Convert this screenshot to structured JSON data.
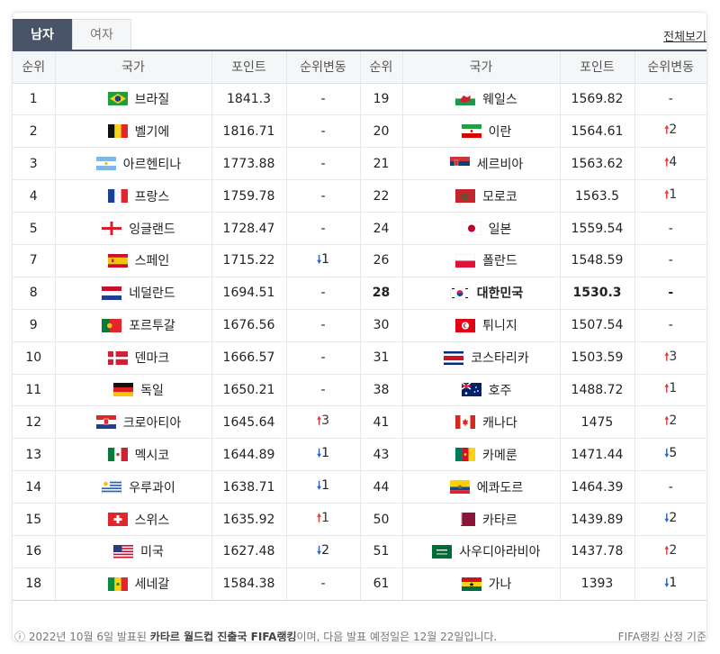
{
  "tabs": [
    {
      "label": "남자",
      "active": true
    },
    {
      "label": "여자",
      "active": false
    }
  ],
  "view_all": "전체보기",
  "headers": [
    "순위",
    "국가",
    "포인트",
    "순위변동",
    "순위",
    "국가",
    "포인트",
    "순위변동"
  ],
  "left": [
    {
      "rank": "1",
      "country": "브라질",
      "points": "1841.3",
      "change": "-",
      "flag": "brazil"
    },
    {
      "rank": "2",
      "country": "벨기에",
      "points": "1816.71",
      "change": "-",
      "flag": "belgium"
    },
    {
      "rank": "3",
      "country": "아르헨티나",
      "points": "1773.88",
      "change": "-",
      "flag": "argentina"
    },
    {
      "rank": "4",
      "country": "프랑스",
      "points": "1759.78",
      "change": "-",
      "flag": "france"
    },
    {
      "rank": "5",
      "country": "잉글랜드",
      "points": "1728.47",
      "change": "-",
      "flag": "england"
    },
    {
      "rank": "7",
      "country": "스페인",
      "points": "1715.22",
      "change": "1",
      "dir": "down",
      "flag": "spain"
    },
    {
      "rank": "8",
      "country": "네덜란드",
      "points": "1694.51",
      "change": "-",
      "flag": "netherlands"
    },
    {
      "rank": "9",
      "country": "포르투갈",
      "points": "1676.56",
      "change": "-",
      "flag": "portugal"
    },
    {
      "rank": "10",
      "country": "덴마크",
      "points": "1666.57",
      "change": "-",
      "flag": "denmark"
    },
    {
      "rank": "11",
      "country": "독일",
      "points": "1650.21",
      "change": "-",
      "flag": "germany"
    },
    {
      "rank": "12",
      "country": "크로아티아",
      "points": "1645.64",
      "change": "3",
      "dir": "up",
      "flag": "croatia"
    },
    {
      "rank": "13",
      "country": "멕시코",
      "points": "1644.89",
      "change": "1",
      "dir": "down",
      "flag": "mexico"
    },
    {
      "rank": "14",
      "country": "우루과이",
      "points": "1638.71",
      "change": "1",
      "dir": "down",
      "flag": "uruguay"
    },
    {
      "rank": "15",
      "country": "스위스",
      "points": "1635.92",
      "change": "1",
      "dir": "up",
      "flag": "switzerland"
    },
    {
      "rank": "16",
      "country": "미국",
      "points": "1627.48",
      "change": "2",
      "dir": "down",
      "flag": "usa"
    },
    {
      "rank": "18",
      "country": "세네갈",
      "points": "1584.38",
      "change": "-",
      "flag": "senegal"
    }
  ],
  "right": [
    {
      "rank": "19",
      "country": "웨일스",
      "points": "1569.82",
      "change": "-",
      "flag": "wales"
    },
    {
      "rank": "20",
      "country": "이란",
      "points": "1564.61",
      "change": "2",
      "dir": "up",
      "flag": "iran"
    },
    {
      "rank": "21",
      "country": "세르비아",
      "points": "1563.62",
      "change": "4",
      "dir": "up",
      "flag": "serbia"
    },
    {
      "rank": "22",
      "country": "모로코",
      "points": "1563.5",
      "change": "1",
      "dir": "up",
      "flag": "morocco"
    },
    {
      "rank": "24",
      "country": "일본",
      "points": "1559.54",
      "change": "-",
      "flag": "japan"
    },
    {
      "rank": "26",
      "country": "폴란드",
      "points": "1548.59",
      "change": "-",
      "flag": "poland"
    },
    {
      "rank": "28",
      "country": "대한민국",
      "points": "1530.3",
      "change": "-",
      "flag": "korea",
      "highlight": true
    },
    {
      "rank": "30",
      "country": "튀니지",
      "points": "1507.54",
      "change": "-",
      "flag": "tunisia"
    },
    {
      "rank": "31",
      "country": "코스타리카",
      "points": "1503.59",
      "change": "3",
      "dir": "up",
      "flag": "costarica"
    },
    {
      "rank": "38",
      "country": "호주",
      "points": "1488.72",
      "change": "1",
      "dir": "up",
      "flag": "australia"
    },
    {
      "rank": "41",
      "country": "캐나다",
      "points": "1475",
      "change": "2",
      "dir": "up",
      "flag": "canada"
    },
    {
      "rank": "43",
      "country": "카메룬",
      "points": "1471.44",
      "change": "5",
      "dir": "down",
      "flag": "cameroon"
    },
    {
      "rank": "44",
      "country": "에콰도르",
      "points": "1464.39",
      "change": "-",
      "flag": "ecuador"
    },
    {
      "rank": "50",
      "country": "카타르",
      "points": "1439.89",
      "change": "2",
      "dir": "down",
      "flag": "qatar"
    },
    {
      "rank": "51",
      "country": "사우디아라비아",
      "points": "1437.78",
      "change": "2",
      "dir": "up",
      "flag": "saudi"
    },
    {
      "rank": "61",
      "country": "가나",
      "points": "1393",
      "change": "1",
      "dir": "down",
      "flag": "ghana"
    }
  ],
  "footer": {
    "note_prefix": "2022년 10월 6일 발표된 ",
    "note_bold": "카타르 월드컵 진출국 FIFA랭킹",
    "note_suffix": "이며, 다음 발표 예정일은 12월 22일입니다.",
    "source": "FIFA랭킹 산정 기준"
  },
  "colors": {
    "accent": "#4a5468",
    "up": "#e03b3b",
    "down": "#2e63c4"
  }
}
